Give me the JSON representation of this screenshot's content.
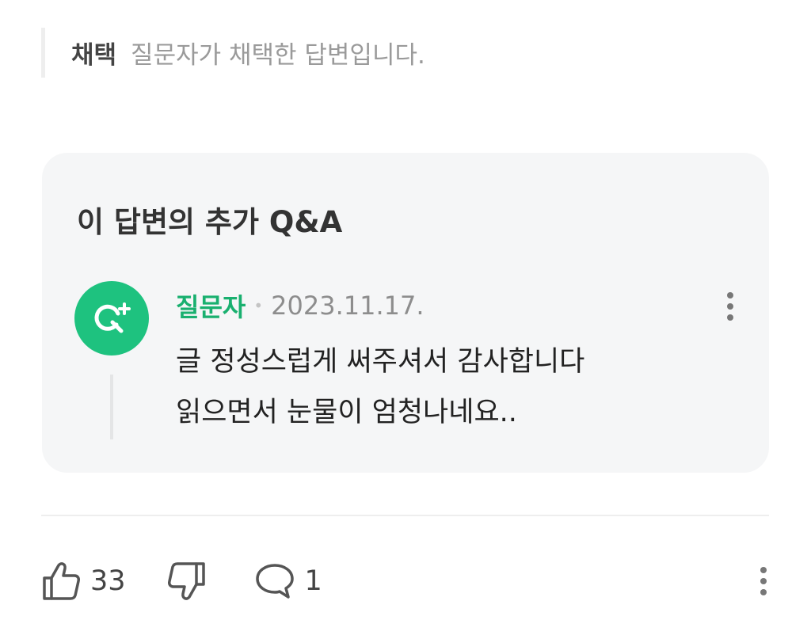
{
  "accepted": {
    "tag": "채택",
    "description": "질문자가 채택한 답변입니다."
  },
  "qa": {
    "title": "이 답변의 추가 Q&A",
    "comment": {
      "author": "질문자",
      "separator": "•",
      "date": "2023.11.17.",
      "lines": [
        "글 정성스럽게 써주셔서 감사합니다",
        "읽으면서 눈물이 엄청나네요.."
      ]
    }
  },
  "reactions": {
    "like_count": "33",
    "comment_count": "1"
  },
  "colors": {
    "brand_green": "#1ec27f",
    "author_green": "#19b06f",
    "card_bg": "#f5f6f7"
  },
  "icons": {
    "avatar": "question-plus-icon",
    "like": "thumbs-up-icon",
    "dislike": "thumbs-down-icon",
    "comment": "speech-bubble-icon",
    "more": "kebab-menu-icon"
  }
}
